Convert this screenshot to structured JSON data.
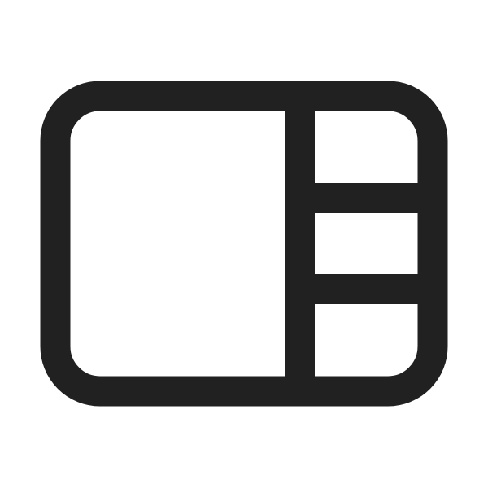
{
  "icon": {
    "name": "panel-layout-right-sidebar-icon",
    "stroke_color": "#212121",
    "background_color": "#ffffff"
  }
}
